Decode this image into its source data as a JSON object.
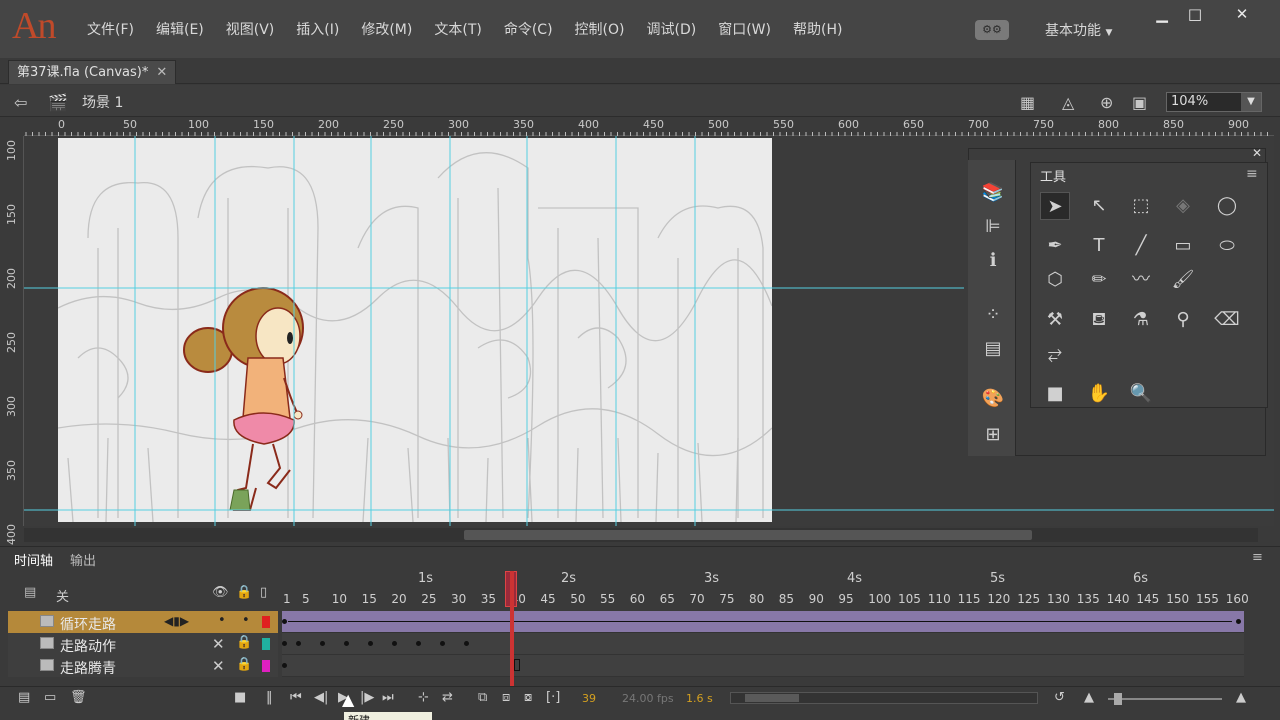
{
  "app": {
    "logo": "An"
  },
  "menu": [
    "文件(F)",
    "编辑(E)",
    "视图(V)",
    "插入(I)",
    "修改(M)",
    "文本(T)",
    "命令(C)",
    "控制(O)",
    "调试(D)",
    "窗口(W)",
    "帮助(H)"
  ],
  "workspace": {
    "label": "基本功能"
  },
  "window": {
    "minimize": "▁",
    "maximize": "□",
    "close": "✕"
  },
  "document": {
    "tab_title": "第37课.fla (Canvas)*",
    "close": "✕"
  },
  "scene": {
    "label": "场景 1",
    "zoom": "104%"
  },
  "rulers": {
    "h_ticks": [
      "0",
      "50",
      "100",
      "150",
      "200",
      "250",
      "300",
      "350",
      "400",
      "450",
      "500",
      "550",
      "600",
      "650",
      "700",
      "750",
      "800",
      "850",
      "900"
    ],
    "v_ticks": [
      "100",
      "150",
      "200",
      "250",
      "300",
      "350",
      "400"
    ]
  },
  "tools": {
    "title": "工具",
    "items": [
      "selection-tool",
      "subselection-tool",
      "free-transform-tool",
      "3d-rotation-tool",
      "lasso-tool",
      "pen-tool",
      "text-tool",
      "line-tool",
      "rectangle-tool",
      "oval-tool",
      "polystar-tool",
      "pencil-tool",
      "paint-brush-tool",
      "brush-tool",
      "bone-tool",
      "paint-bucket-tool",
      "ink-bottle-tool",
      "eyedropper-tool",
      "eraser-tool",
      "width-tool",
      "camera-tool",
      "hand-tool",
      "zoom-tool"
    ]
  },
  "timeline": {
    "tabs": [
      "时间轴",
      "输出"
    ],
    "layer_header": "关",
    "seconds": [
      "1s",
      "2s",
      "3s",
      "4s",
      "5s",
      "6s"
    ],
    "frame_ticks": [
      "1",
      "5",
      "10",
      "15",
      "20",
      "25",
      "30",
      "35",
      "40",
      "45",
      "50",
      "55",
      "60",
      "65",
      "70",
      "75",
      "80",
      "85",
      "90",
      "95",
      "100",
      "105",
      "110",
      "115",
      "120",
      "125",
      "130",
      "135",
      "140",
      "145",
      "150",
      "155",
      "160"
    ],
    "layers": [
      {
        "name": "循环走路",
        "active": true
      },
      {
        "name": "走路动作",
        "active": false
      },
      {
        "name": "走路腾青",
        "active": false
      }
    ],
    "current_frame": "39",
    "fps": "24.00 fps",
    "time": "1.6 s",
    "tooltip": "新建"
  },
  "colors": {
    "accent": "#b5893a",
    "playhead": "#cc3333",
    "guide": "#55cfe0",
    "logo": "#c04a2a"
  }
}
